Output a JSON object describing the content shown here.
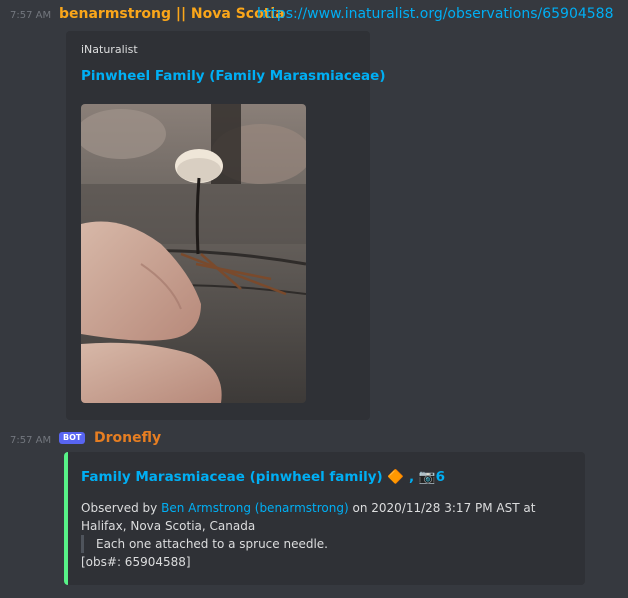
{
  "message1": {
    "time": "7:57 AM",
    "author": "benarmstrong || Nova Scotia",
    "link": "https://www.inaturalist.org/observations/65904588",
    "embed": {
      "provider": "iNaturalist",
      "title": "Pinwheel Family (Family Marasmiaceae)"
    }
  },
  "message2": {
    "time": "7:57 AM",
    "badge": "BOT",
    "author": "Dronefly",
    "embed": {
      "title_main": "Family Marasmiaceae (pinwheel family)",
      "title_diamond": "🔶",
      "title_sep": ",",
      "title_icon": "📷",
      "title_count": "6",
      "observed_by_prefix": "Observed by",
      "observer": "Ben Armstrong (benarmstrong)",
      "observed_on": "on 2020/11/28 3:17 PM AST at",
      "place": "Halifax, Nova Scotia, Canada",
      "quote": "Each one attached to a spruce needle.",
      "obs_ref": "[obs#: 65904588]"
    }
  },
  "colors": {
    "background": "#36393f",
    "embed_bg": "#2f3136",
    "author1": "#faa61a",
    "author2": "#e67e22",
    "link": "#00aff4",
    "embed_border": "#57f287",
    "bot_badge": "#5865f2"
  }
}
